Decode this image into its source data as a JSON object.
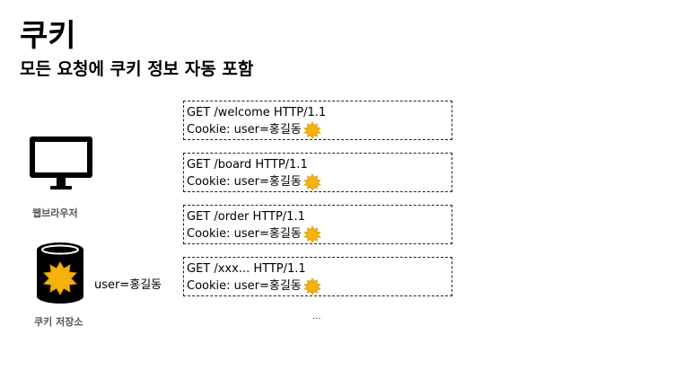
{
  "title": "쿠키",
  "subtitle": "모든 요청에 쿠키 정보 자동 포함",
  "browser": {
    "label": "웹브라우저",
    "icon": "monitor-icon"
  },
  "cookie_store": {
    "label": "쿠키 저장소",
    "cookie": "user=홍길동",
    "icon": "database-icon"
  },
  "requests": [
    {
      "request_line": "GET /welcome HTTP/1.1",
      "cookie_header": "Cookie: user=홍길동"
    },
    {
      "request_line": "GET /board HTTP/1.1",
      "cookie_header": "Cookie: user=홍길동"
    },
    {
      "request_line": "GET /order HTTP/1.1",
      "cookie_header": "Cookie: user=홍길동"
    },
    {
      "request_line": "GET /xxx... HTTP/1.1",
      "cookie_header": "Cookie: user=홍길동"
    }
  ],
  "ellipsis": "...",
  "colors": {
    "cookie": "#f5b20f",
    "cookie_outline": "#e09a00",
    "text": "#000000",
    "label": "#555555"
  }
}
